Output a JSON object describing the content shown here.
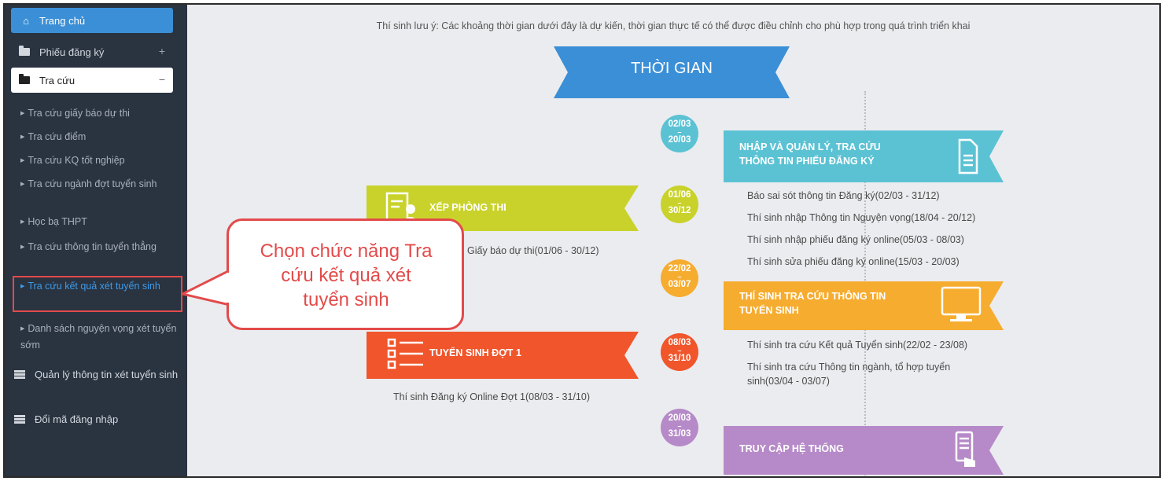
{
  "sidebar": {
    "home": {
      "label": "Trang chủ",
      "icon": "home-icon"
    },
    "registration": {
      "label": "Phiếu đăng ký",
      "sign": "+"
    },
    "lookup": {
      "label": "Tra cứu",
      "sign": "−"
    },
    "sub_items": [
      {
        "label": "Tra cứu giấy báo dự thi"
      },
      {
        "label": "Tra cứu điểm"
      },
      {
        "label": "Tra cứu KQ tốt nghiệp"
      },
      {
        "label": "Tra cứu ngành đợt tuyển sinh"
      },
      {
        "label": "Học bạ THPT"
      },
      {
        "label": "Tra cứu thông tin tuyển thẳng"
      },
      {
        "label": "Tra cứu kết quả xét tuyển sinh"
      },
      {
        "label": "Danh sách nguyện vọng xét tuyển sớm"
      }
    ],
    "manage": {
      "label": "Quản lý thông tin xét tuyển sinh"
    },
    "change_login": {
      "label": "Đổi mã đăng nhập"
    }
  },
  "main": {
    "notice": "Thí sinh lưu ý: Các khoảng thời gian dưới đây là dự kiến, thời gian thực tế có thể được điều chỉnh cho phù hợp trong quá trình triển khai",
    "banner": "THỜI GIAN",
    "dots": [
      {
        "start": "02/03",
        "end": "20/03",
        "color": "#5bc2d4"
      },
      {
        "start": "01/06",
        "end": "30/12",
        "color": "#c9d22b"
      },
      {
        "start": "22/02",
        "end": "03/07",
        "color": "#f6ac2f"
      },
      {
        "start": "08/03",
        "end": "31/10",
        "color": "#f0552b"
      },
      {
        "start": "20/03",
        "end": "31/03",
        "color": "#b68ac8"
      }
    ],
    "sections": {
      "register_info": {
        "title_line1": "NHẬP VÀ QUẢN LÝ, TRA CỨU",
        "title_line2": "THÔNG TIN PHIẾU ĐĂNG KÝ",
        "color": "#5bc2d4",
        "items": [
          "Báo sai sót thông tin Đăng ký(02/03 - 31/12)",
          "Thí sinh nhập Thông tin Nguyện vọng(18/04 - 20/12)",
          "Thí sinh nhập phiếu đăng ký online(05/03 - 08/03)",
          "Thí sinh sửa phiếu đăng ký online(15/03 - 20/03)"
        ]
      },
      "exam_room": {
        "title": "XẾP PHÒNG THI",
        "color": "#c9d22b",
        "item": "Giấy báo dự thi(01/06 - 30/12)"
      },
      "lookup_info": {
        "title_line1": "THÍ SINH TRA CỨU THÔNG TIN",
        "title_line2": "TUYỂN SINH",
        "color": "#f6ac2f",
        "items": [
          "Thí sinh tra cứu Kết quả Tuyển sinh(22/02 - 23/08)",
          "Thí sinh tra cứu Thông tin ngành, tổ hợp tuyển",
          "sinh(03/04 - 03/07)"
        ]
      },
      "round1": {
        "title": "TUYỂN SINH ĐỢT 1",
        "color": "#f0552b",
        "item": "Thí sinh Đăng ký Online Đợt 1(08/03 - 31/10)"
      },
      "system_access": {
        "title": "TRUY CẬP HỆ THỐNG",
        "color": "#b68ac8"
      }
    },
    "callout": {
      "line1": "Chọn chức năng Tra",
      "line2": "cứu kết quả xét",
      "line3": "tuyển sinh"
    }
  }
}
